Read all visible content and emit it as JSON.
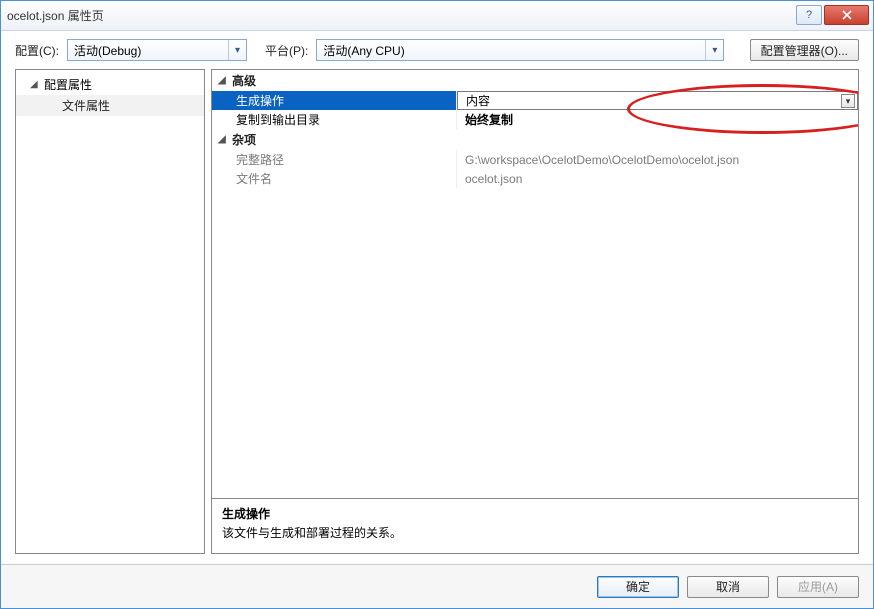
{
  "window": {
    "title": "ocelot.json 属性页",
    "help_tip": "?"
  },
  "toolbar": {
    "config_label": "配置(C):",
    "config_value": "活动(Debug)",
    "platform_label": "平台(P):",
    "platform_value": "活动(Any CPU)",
    "config_manager_label": "配置管理器(O)..."
  },
  "tree": {
    "root": "配置属性",
    "items": [
      "文件属性"
    ]
  },
  "propgrid": {
    "categories": [
      {
        "name": "高级",
        "rows": [
          {
            "name": "生成操作",
            "value": "内容",
            "selected": true,
            "dropdown": true
          },
          {
            "name": "复制到输出目录",
            "value": "始终复制",
            "bold": true
          }
        ]
      },
      {
        "name": "杂项",
        "rows": [
          {
            "name": "完整路径",
            "value": "G:\\workspace\\OcelotDemo\\OcelotDemo\\ocelot.json",
            "readonly": true
          },
          {
            "name": "文件名",
            "value": "ocelot.json",
            "readonly": true
          }
        ]
      }
    ],
    "description": {
      "title": "生成操作",
      "text": "该文件与生成和部署过程的关系。"
    }
  },
  "footer": {
    "ok": "确定",
    "cancel": "取消",
    "apply": "应用(A)"
  }
}
